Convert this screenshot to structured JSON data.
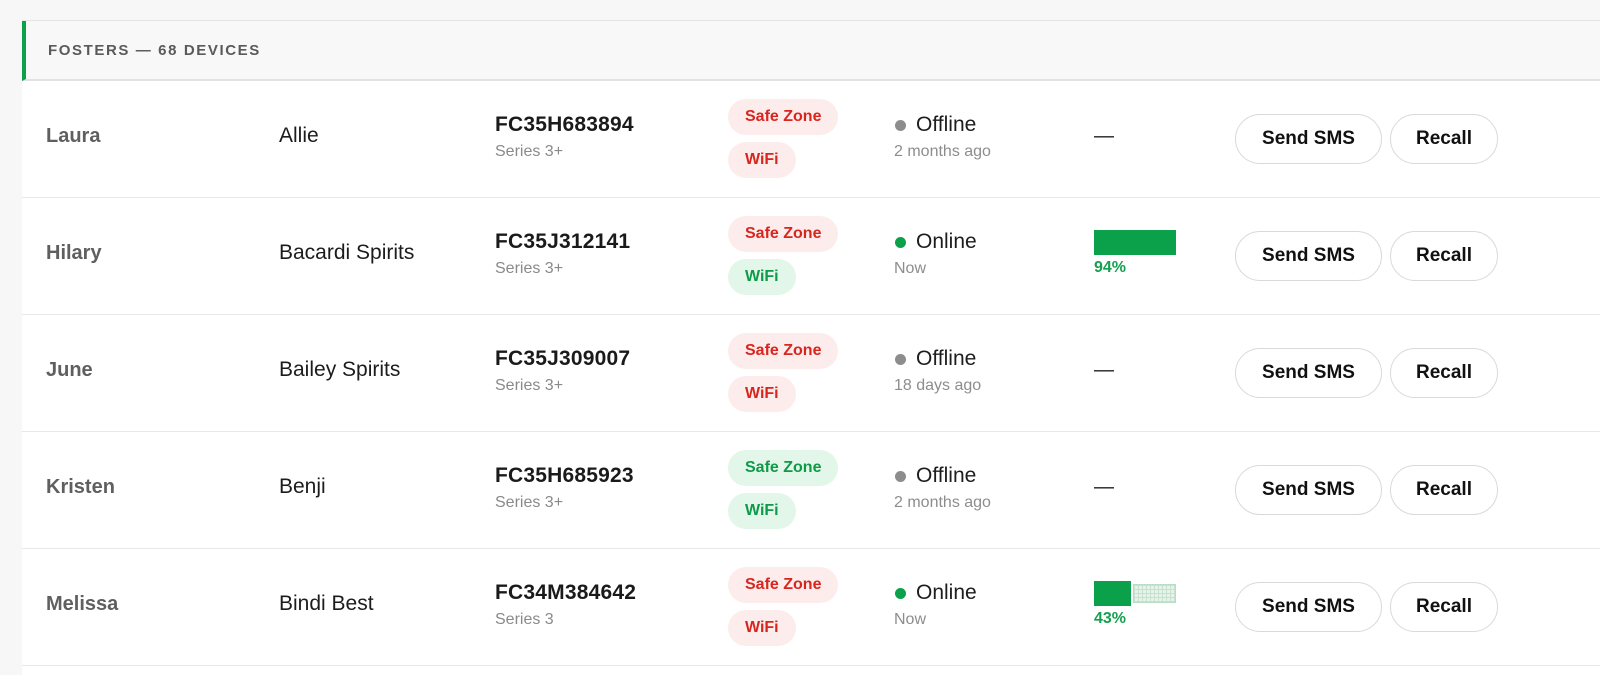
{
  "section": {
    "title": "FOSTERS — 68 DEVICES"
  },
  "actions": {
    "sms_label": "Send SMS",
    "recall_label": "Recall"
  },
  "colors": {
    "accent": "#0aa14a",
    "alert_text": "#d7261e",
    "alert_bg": "#fdecec",
    "ok_text": "#0e9a48",
    "ok_bg": "#e3f6ea"
  },
  "rows": [
    {
      "foster": "Laura",
      "dog": "Allie",
      "device_id": "FC35H683894",
      "series": "Series 3+",
      "safe_zone": {
        "label": "Safe Zone",
        "ok": false
      },
      "wifi": {
        "label": "WiFi",
        "ok": false
      },
      "status": "Offline",
      "online": false,
      "last_seen": "2 months ago",
      "battery_text": "—",
      "battery_level": null
    },
    {
      "foster": "Hilary",
      "dog": "Bacardi Spirits",
      "device_id": "FC35J312141",
      "series": "Series 3+",
      "safe_zone": {
        "label": "Safe Zone",
        "ok": false
      },
      "wifi": {
        "label": "WiFi",
        "ok": true
      },
      "status": "Online",
      "online": true,
      "last_seen": "Now",
      "battery_text": "94%",
      "battery_level": 0.94
    },
    {
      "foster": "June",
      "dog": "Bailey Spirits",
      "device_id": "FC35J309007",
      "series": "Series 3+",
      "safe_zone": {
        "label": "Safe Zone",
        "ok": false
      },
      "wifi": {
        "label": "WiFi",
        "ok": false
      },
      "status": "Offline",
      "online": false,
      "last_seen": "18 days ago",
      "battery_text": "—",
      "battery_level": null
    },
    {
      "foster": "Kristen",
      "dog": "Benji",
      "device_id": "FC35H685923",
      "series": "Series 3+",
      "safe_zone": {
        "label": "Safe Zone",
        "ok": true
      },
      "wifi": {
        "label": "WiFi",
        "ok": true
      },
      "status": "Offline",
      "online": false,
      "last_seen": "2 months ago",
      "battery_text": "—",
      "battery_level": null
    },
    {
      "foster": "Melissa",
      "dog": "Bindi Best",
      "device_id": "FC34M384642",
      "series": "Series 3",
      "safe_zone": {
        "label": "Safe Zone",
        "ok": false
      },
      "wifi": {
        "label": "WiFi",
        "ok": false
      },
      "status": "Online",
      "online": true,
      "last_seen": "Now",
      "battery_text": "43%",
      "battery_level": 0.43
    }
  ]
}
